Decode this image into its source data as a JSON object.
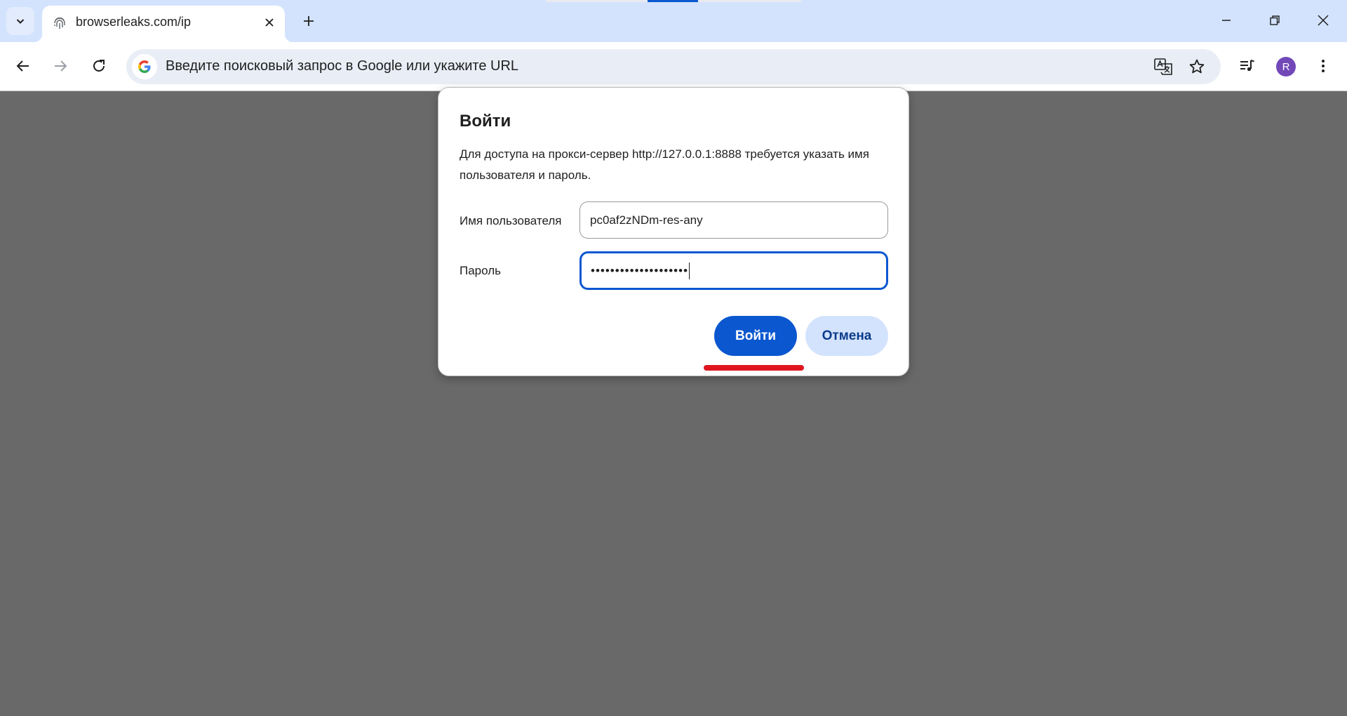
{
  "browser": {
    "tab": {
      "title": "browserleaks.com/ip",
      "favicon": "fingerprint-icon"
    },
    "new_tab_icon": "plus-icon",
    "window_controls": [
      "minimize-icon",
      "restore-icon",
      "close-icon"
    ],
    "toolbar": {
      "back_icon": "arrow-left-icon",
      "forward_icon": "arrow-right-icon",
      "reload_icon": "reload-icon",
      "omnibox_placeholder": "Введите поисковый запрос в Google или укажите URL",
      "translate_icon": "translate-icon",
      "bookmark_icon": "star-icon",
      "media_icon": "media-queue-icon",
      "profile_initial": "R",
      "menu_icon": "kebab-menu-icon"
    }
  },
  "dialog": {
    "title": "Войти",
    "message": "Для доступа на прокси-сервер http://127.0.0.1:8888 требуется указать имя пользователя и пароль.",
    "username_label": "Имя пользователя",
    "username_value": "pc0af2zNDm-res-any",
    "password_label": "Пароль",
    "password_masked": "••••••••••••••••••••",
    "ok_label": "Войти",
    "cancel_label": "Отмена"
  },
  "colors": {
    "tabstrip": "#d3e3fd",
    "page_overlay": "#696969",
    "accent": "#0b57d0",
    "annotation": "#e0161f",
    "avatar": "#7248b9"
  }
}
